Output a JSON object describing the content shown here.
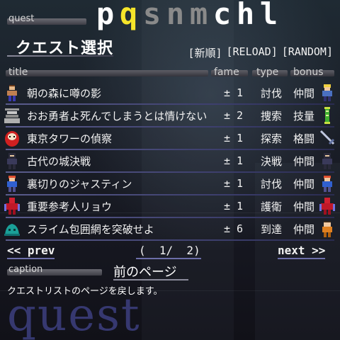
{
  "header": {
    "tag_label": "quest",
    "title_letters": [
      {
        "ch": "p",
        "color": "#ffffff"
      },
      {
        "ch": "q",
        "color": "#f6e52a"
      },
      {
        "ch": "s",
        "color": "#8a8a8a"
      },
      {
        "ch": "n",
        "color": "#8a8a8a"
      },
      {
        "ch": "m",
        "color": "#8a8a8a"
      },
      {
        "ch": "c",
        "color": "#ffffff"
      },
      {
        "ch": "h",
        "color": "#ffffff"
      },
      {
        "ch": "l",
        "color": "#ffffff"
      }
    ],
    "screen_title": "クエスト選択"
  },
  "sort_buttons": [
    "[新順]",
    "[RELOAD]",
    "[RANDOM]"
  ],
  "columns": {
    "title": "title",
    "fame": "fame",
    "type": "type",
    "bonus": "bonus"
  },
  "quests": [
    {
      "title": "朝の森に噂の影",
      "fame": "± 1",
      "type": "討伐",
      "bonus": "仲間",
      "icon": "fighter-icon",
      "bonus_icon": "ally-blonde-icon"
    },
    {
      "title": "おお勇者よ死んでしまうとは情けない",
      "fame": "± 2",
      "type": "捜索",
      "bonus": "技量",
      "icon": "shrine-icon",
      "bonus_icon": "scroll-icon"
    },
    {
      "title": "東京タワーの偵察",
      "fame": "± 1",
      "type": "探索",
      "bonus": "格闘",
      "icon": "daruma-icon",
      "bonus_icon": "sword-icon"
    },
    {
      "title": "古代の城決戦",
      "fame": "± 1",
      "type": "決戦",
      "bonus": "仲間",
      "icon": "ninja-icon",
      "bonus_icon": "ally-ninja-icon"
    },
    {
      "title": "裏切りのジャスティン",
      "fame": "± 1",
      "type": "討伐",
      "bonus": "仲間",
      "icon": "hero-icon",
      "bonus_icon": "ally-hero-icon"
    },
    {
      "title": "重要参考人リョウ",
      "fame": "± 1",
      "type": "護衛",
      "bonus": "仲間",
      "icon": "red-knight-icon",
      "bonus_icon": "ally-red-knight-icon"
    },
    {
      "title": "スライム包囲網を突破せよ",
      "fame": "± 6",
      "type": "到達",
      "bonus": "仲間",
      "icon": "slime-icon",
      "bonus_icon": "ally-monk-icon"
    }
  ],
  "pagination": {
    "prev": "<< prev",
    "next": "next >>",
    "indicator": "(  1/  2)"
  },
  "caption": {
    "tag_label": "caption",
    "title": "前のページ",
    "text": "クエストリストのページを戻します。"
  },
  "watermark": "quest",
  "colors": {
    "accent": "#f6e52a",
    "row_line": "#5a5c8c",
    "watermark": "#3a3d7a"
  }
}
